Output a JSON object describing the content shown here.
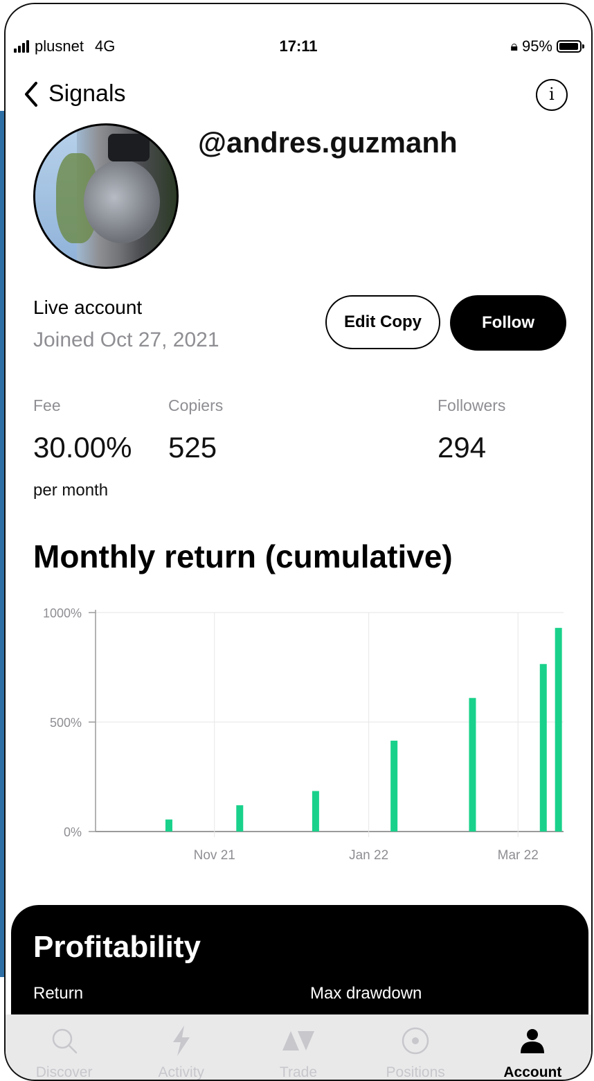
{
  "status_bar": {
    "carrier": "plusnet",
    "network": "4G",
    "time": "17:11",
    "battery": "95%",
    "battery_level": 0.95
  },
  "nav": {
    "back_label": "Signals"
  },
  "profile": {
    "username": "@andres.guzmanh",
    "account_type": "Live account",
    "joined": "Joined Oct 27, 2021"
  },
  "actions": {
    "edit_copy": "Edit Copy",
    "follow": "Follow"
  },
  "stats": {
    "fee_label": "Fee",
    "fee_value": "30.00%",
    "fee_period": "per month",
    "copiers_label": "Copiers",
    "copiers_value": "525",
    "followers_label": "Followers",
    "followers_value": "294"
  },
  "chart_section": {
    "title": "Monthly return (cumulative)"
  },
  "chart_data": {
    "type": "bar",
    "y_tick_labels": [
      "0%",
      "500%",
      "1000%"
    ],
    "y_ticks": [
      0,
      500,
      1000
    ],
    "ylim": [
      0,
      1000
    ],
    "x_tick_labels": [
      "Nov 21",
      "Jan 22",
      "Mar 22"
    ],
    "x_ticks": [
      {
        "label": "Nov 21",
        "date": "2021-11-01"
      },
      {
        "label": "Jan 22",
        "date": "2022-01-01"
      },
      {
        "label": "Mar 22",
        "date": "2022-03-01"
      }
    ],
    "bars": [
      {
        "date": "2021-10-14",
        "value": 55
      },
      {
        "date": "2021-11-11",
        "value": 120
      },
      {
        "date": "2021-12-11",
        "value": 185
      },
      {
        "date": "2022-01-11",
        "value": 415
      },
      {
        "date": "2022-02-11",
        "value": 610
      },
      {
        "date": "2022-03-11",
        "value": 765
      },
      {
        "date": "2022-03-17",
        "value": 930
      }
    ],
    "bar_color": "#19d18b",
    "grid": true
  },
  "profitability": {
    "title": "Profitability",
    "return_label": "Return",
    "max_drawdown_label": "Max drawdown"
  },
  "tab_bar": {
    "tabs": [
      {
        "label": "Discover",
        "icon": "search-icon"
      },
      {
        "label": "Activity",
        "icon": "lightning-icon"
      },
      {
        "label": "Trade",
        "icon": "trade-arrows-icon"
      },
      {
        "label": "Positions",
        "icon": "target-icon"
      },
      {
        "label": "Account",
        "icon": "person-icon"
      }
    ],
    "active": "Account"
  }
}
